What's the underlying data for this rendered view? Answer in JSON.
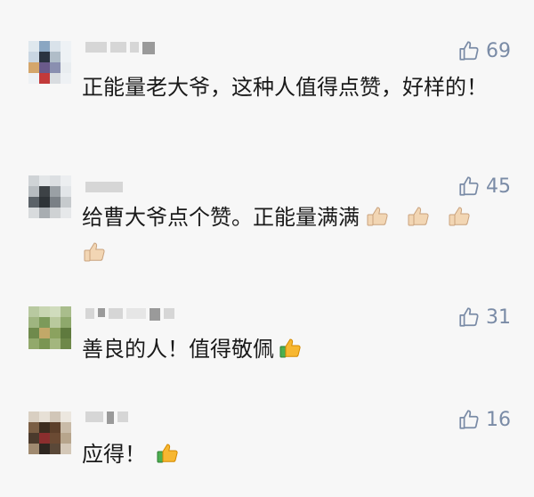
{
  "comments": [
    {
      "text": "正能量老大爷，这种人值得点赞，好样的！",
      "likes": "69",
      "thumb_emojis": 0
    },
    {
      "text": "给曹大爷点个赞。正能量满满",
      "likes": "45",
      "thumb_emojis": 4,
      "emoji_style": "pale"
    },
    {
      "text": "善良的人！值得敬佩",
      "likes": "31",
      "thumb_emojis": 1,
      "emoji_style": "yellow"
    },
    {
      "text": "应得！",
      "likes": "16",
      "thumb_emojis": 1,
      "emoji_style": "yellow"
    }
  ],
  "colors": {
    "like": "#7a8ba6",
    "text": "#1a1a1a",
    "background": "#f7f7f7"
  }
}
